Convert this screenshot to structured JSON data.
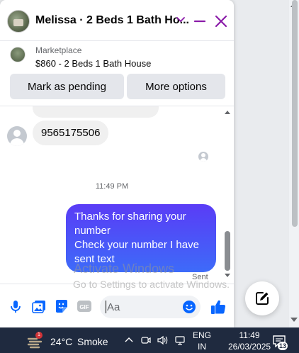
{
  "chat": {
    "title": "Melissa · 2 Beds 1 Bath Ho...",
    "accent_color": "#8a1ba8"
  },
  "marketplace": {
    "label": "Marketplace",
    "listing": "$860 - 2 Beds 1 Bath House",
    "mark_pending_label": "Mark as pending",
    "more_options_label": "More options"
  },
  "messages": {
    "received_text": "9565175506",
    "timestamp": "11:49 PM",
    "sent_lines": [
      "Thanks for sharing your number",
      "Check your number I have sent text"
    ],
    "sent_status": "Sent"
  },
  "composer": {
    "placeholder": "Aa",
    "icons": [
      "microphone-icon",
      "photo-icon",
      "sticker-icon",
      "gif-icon",
      "emoji-icon",
      "like-icon"
    ]
  },
  "watermark": {
    "line1": "Activate Windows",
    "line2": "Go to Settings to activate Windows."
  },
  "taskbar": {
    "weather_temp": "24°C",
    "weather_condition": "Smoke",
    "weather_badge": "1",
    "language_top": "ENG",
    "language_bottom": "IN",
    "time": "11:49",
    "date": "26/03/2025",
    "notification_count": "13"
  }
}
